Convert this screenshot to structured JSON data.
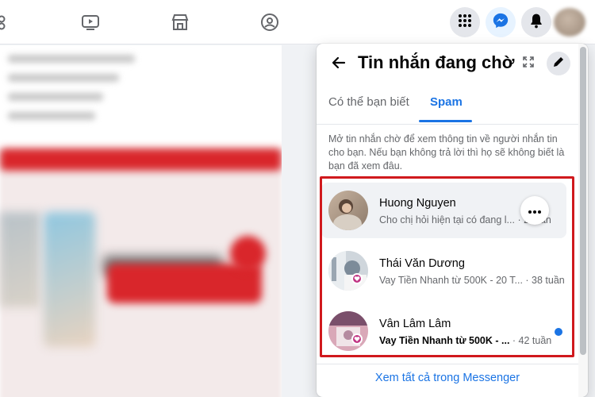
{
  "topbar": {
    "nav_icons": [
      "groups-icon",
      "watch-icon",
      "marketplace-icon",
      "gaming-icon"
    ],
    "right_icons": [
      "menu-grid-icon",
      "messenger-icon",
      "notifications-icon"
    ],
    "accent": "#1b74e4"
  },
  "panel": {
    "title": "Tin nhắn đang chờ",
    "tabs": [
      {
        "label": "Có thể bạn biết",
        "active": false
      },
      {
        "label": "Spam",
        "active": true
      }
    ],
    "info": "Mở tin nhắn chờ để xem thông tin về người nhắn tin cho bạn. Nếu bạn không trả lời thì họ sẽ không biết là bạn đã xem đâu.",
    "messages": [
      {
        "name": "Huong Nguyen",
        "preview": "Cho chị hỏi hiện tại có đang l...",
        "time": "· 2 tuần"
      },
      {
        "name": "Thái Văn Dương",
        "preview": "Vay Tiền Nhanh từ 500K - 20 T...",
        "time": "· 38 tuần"
      },
      {
        "name": "Vân Lâm Lâm",
        "preview": "Vay Tiền Nhanh từ 500K - ...",
        "time": "· 42 tuần"
      }
    ],
    "footer_link": "Xem tất cả trong Messenger"
  },
  "colors": {
    "highlight_border": "#d0191d",
    "link_blue": "#1b74e4"
  }
}
